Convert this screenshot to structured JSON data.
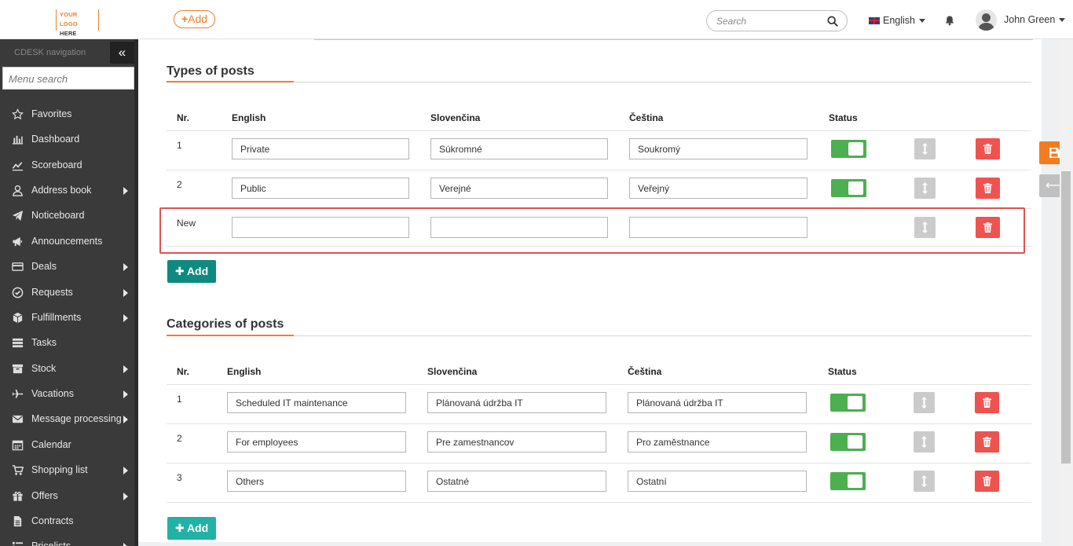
{
  "header": {
    "logo_line1": "YOUR LOGO",
    "logo_line2": "HERE",
    "add_label": "Add",
    "search_placeholder": "Search",
    "language": "English",
    "user_name": "John Green"
  },
  "sidebar": {
    "title": "CDESK navigation",
    "collapse_icon": "«",
    "menu_search_placeholder": "Menu search",
    "items": [
      {
        "label": "Favorites",
        "icon": "star-icon",
        "has_submenu": false
      },
      {
        "label": "Dashboard",
        "icon": "bar-chart-icon",
        "has_submenu": false
      },
      {
        "label": "Scoreboard",
        "icon": "line-chart-icon",
        "has_submenu": false
      },
      {
        "label": "Address book",
        "icon": "user-icon",
        "has_submenu": true
      },
      {
        "label": "Noticeboard",
        "icon": "paper-plane-icon",
        "has_submenu": false
      },
      {
        "label": "Announcements",
        "icon": "megaphone-icon",
        "has_submenu": false
      },
      {
        "label": "Deals",
        "icon": "credit-card-icon",
        "has_submenu": true
      },
      {
        "label": "Requests",
        "icon": "check-circle-icon",
        "has_submenu": true
      },
      {
        "label": "Fulfillments",
        "icon": "cube-icon",
        "has_submenu": true
      },
      {
        "label": "Tasks",
        "icon": "tasks-icon",
        "has_submenu": false
      },
      {
        "label": "Stock",
        "icon": "archive-icon",
        "has_submenu": true
      },
      {
        "label": "Vacations",
        "icon": "plane-icon",
        "has_submenu": true
      },
      {
        "label": "Message processing",
        "icon": "envelope-icon",
        "has_submenu": true
      },
      {
        "label": "Calendar",
        "icon": "calendar-icon",
        "has_submenu": false
      },
      {
        "label": "Shopping list",
        "icon": "cart-icon",
        "has_submenu": true
      },
      {
        "label": "Offers",
        "icon": "gift-icon",
        "has_submenu": true
      },
      {
        "label": "Contracts",
        "icon": "document-icon",
        "has_submenu": false
      },
      {
        "label": "Pricelists",
        "icon": "list-icon",
        "has_submenu": true
      }
    ]
  },
  "types_section": {
    "title": "Types of posts",
    "headers": {
      "nr": "Nr.",
      "english": "English",
      "slovak": "Slovenčina",
      "czech": "Čeština",
      "status": "Status"
    },
    "rows": [
      {
        "nr": "1",
        "english": "Private",
        "slovak": "Súkromné",
        "czech": "Soukromý",
        "status_on": true
      },
      {
        "nr": "2",
        "english": "Public",
        "slovak": "Verejné",
        "czech": "Veřejný",
        "status_on": true
      },
      {
        "nr": "New",
        "english": "",
        "slovak": "",
        "czech": ""
      }
    ],
    "add_label": "Add"
  },
  "categories_section": {
    "title": "Categories of posts",
    "headers": {
      "nr": "Nr.",
      "english": "English",
      "slovak": "Slovenčina",
      "czech": "Čeština",
      "status": "Status"
    },
    "rows": [
      {
        "nr": "1",
        "english": "Scheduled IT maintenance",
        "slovak": "Plánovaná údržba IT",
        "czech": "Plánovaná údržba IT",
        "status_on": true
      },
      {
        "nr": "2",
        "english": "For employees",
        "slovak": "Pre zamestnancov",
        "czech": "Pro zaměstnance",
        "status_on": true
      },
      {
        "nr": "3",
        "english": "Others",
        "slovak": "Ostatné",
        "czech": "Ostatní",
        "status_on": true
      }
    ],
    "add_label": "Add"
  },
  "floating": {
    "save_icon": "floppy-disk-icon",
    "back_icon": "arrow-left-icon"
  },
  "colors": {
    "accent": "#f07f2c",
    "sidebar_bg": "#3a3a3a",
    "toggle_on": "#4caf50",
    "delete_red": "#ef5350",
    "add_teal_dark": "#0e8a80",
    "add_teal_light": "#21b2a6",
    "highlight_border": "#e05252"
  }
}
